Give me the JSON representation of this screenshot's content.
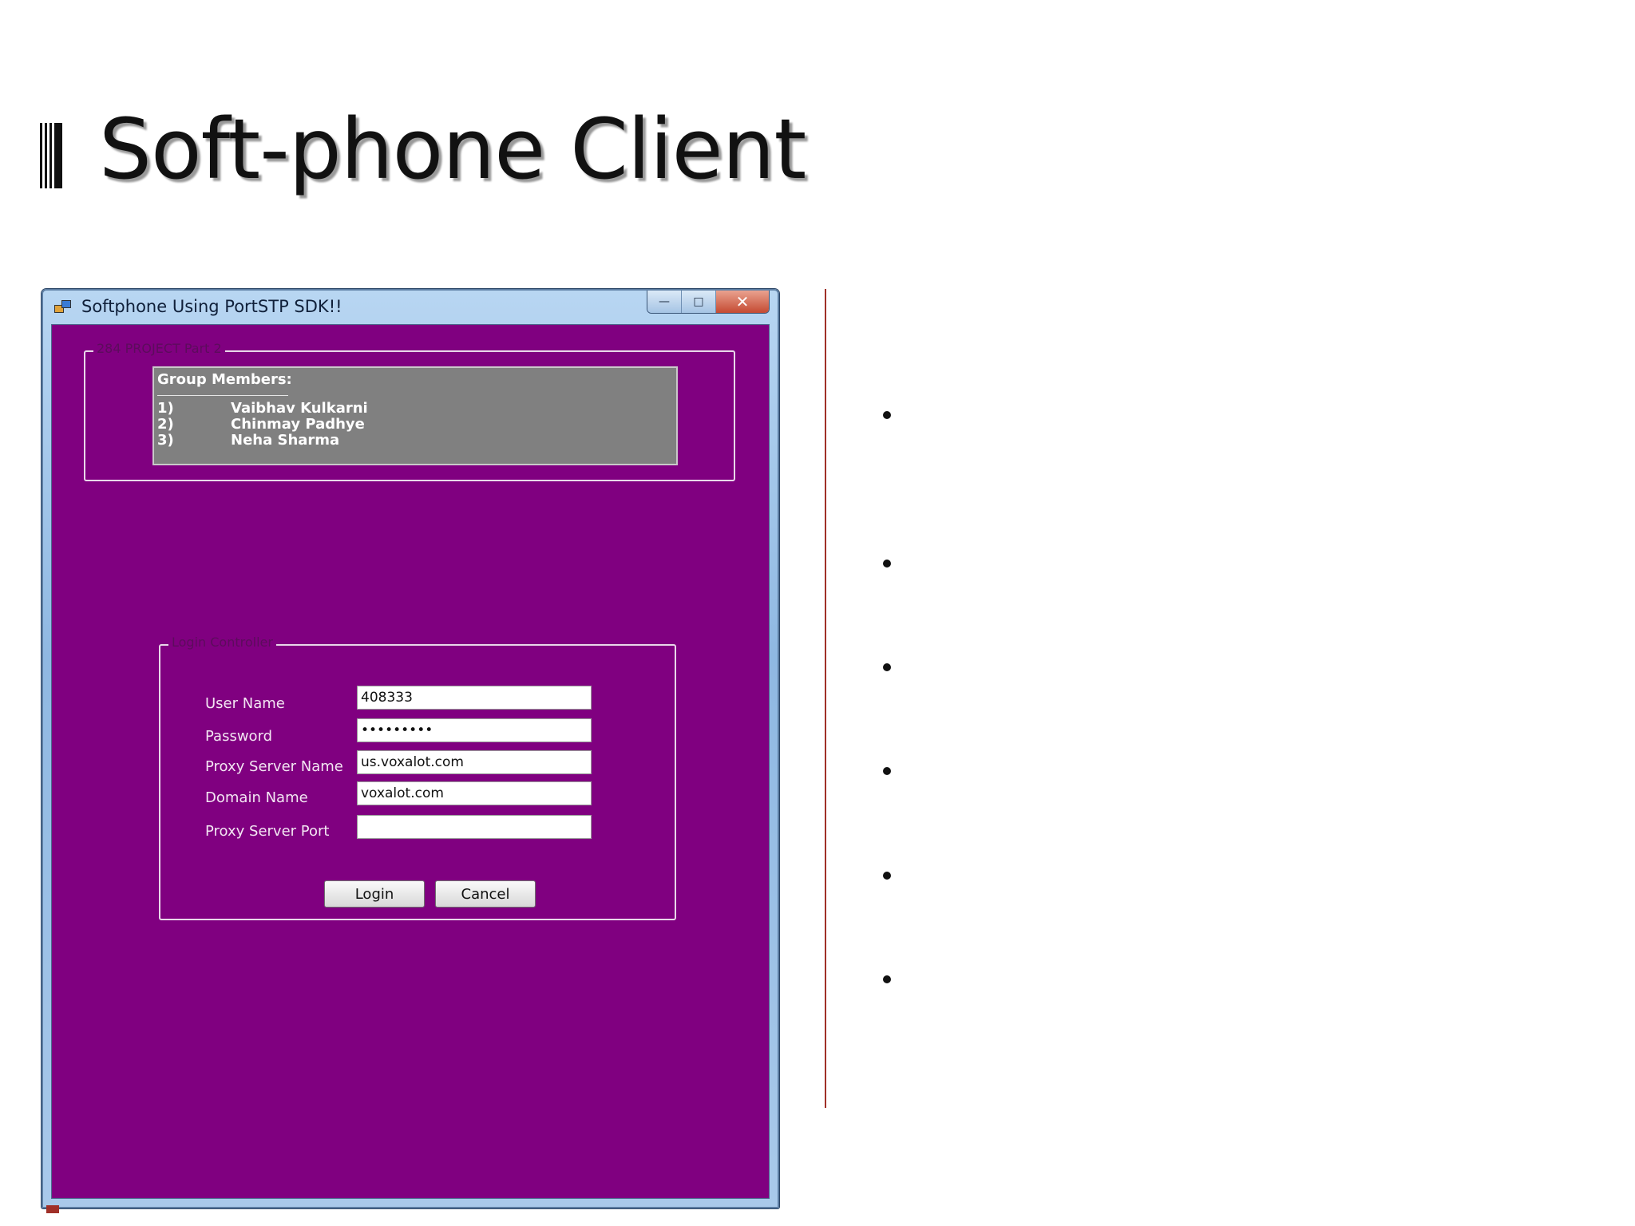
{
  "slide": {
    "title": "Soft-phone Client",
    "bullet_count": 6
  },
  "window": {
    "title": "Softphone Using PortSTP SDK!!",
    "controls": {
      "minimize": "—",
      "maximize": "□",
      "close": "✕"
    }
  },
  "project_group": {
    "legend": "284 PROJECT Part 2",
    "members": {
      "heading": "Group Members:",
      "list": [
        {
          "num": "1)",
          "name": "Vaibhav Kulkarni"
        },
        {
          "num": "2)",
          "name": "Chinmay Padhye"
        },
        {
          "num": "3)",
          "name": "Neha Sharma"
        }
      ]
    }
  },
  "login": {
    "legend": "Login Controller",
    "fields": {
      "user_name": {
        "label": "User Name",
        "value": "408333"
      },
      "password": {
        "label": "Password",
        "value": "•••••••••"
      },
      "proxy_server_name": {
        "label": "Proxy Server Name",
        "value": "us.voxalot.com"
      },
      "domain_name": {
        "label": "Domain Name",
        "value": "voxalot.com"
      },
      "proxy_server_port": {
        "label": "Proxy Server Port",
        "value": ""
      }
    },
    "login_label": "Login",
    "cancel_label": "Cancel"
  },
  "colors": {
    "client_background": "#800080",
    "divider": "#a03028"
  }
}
